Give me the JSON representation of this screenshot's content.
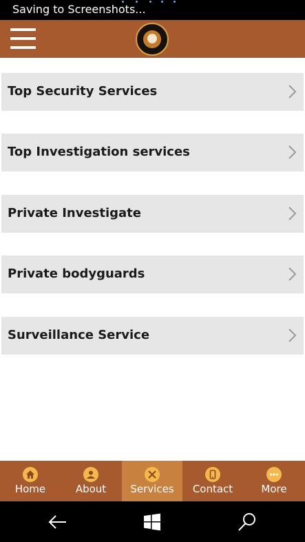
{
  "status_bar": {
    "text": "Saving to Screenshots..."
  },
  "header": {
    "menu_icon": "hamburger-icon",
    "logo_icon": "tiger-badge-logo"
  },
  "menu": {
    "items": [
      {
        "label": "Top Security Services",
        "icon": "chevron-right-icon"
      },
      {
        "label": "Top Investigation services",
        "icon": "chevron-right-icon"
      },
      {
        "label": "Private Investigate",
        "icon": "chevron-right-icon"
      },
      {
        "label": "Private bodyguards",
        "icon": "chevron-right-icon"
      },
      {
        "label": "Surveillance Service",
        "icon": "chevron-right-icon"
      }
    ]
  },
  "bottom_nav": {
    "items": [
      {
        "label": "Home",
        "icon": "home-icon"
      },
      {
        "label": "About",
        "icon": "person-icon"
      },
      {
        "label": "Services",
        "icon": "tools-icon",
        "active": true
      },
      {
        "label": "Contact",
        "icon": "phone-icon"
      },
      {
        "label": "More",
        "icon": "more-dots-icon"
      }
    ]
  },
  "system_nav": {
    "back_icon": "back-arrow-icon",
    "start_icon": "windows-icon",
    "search_icon": "search-icon"
  },
  "colors": {
    "header_bg": "#a75a2e",
    "nav_active_bg": "#c9813f",
    "nav_icon_bg": "#f5b84a",
    "menu_item_bg": "#e6e6e6"
  }
}
